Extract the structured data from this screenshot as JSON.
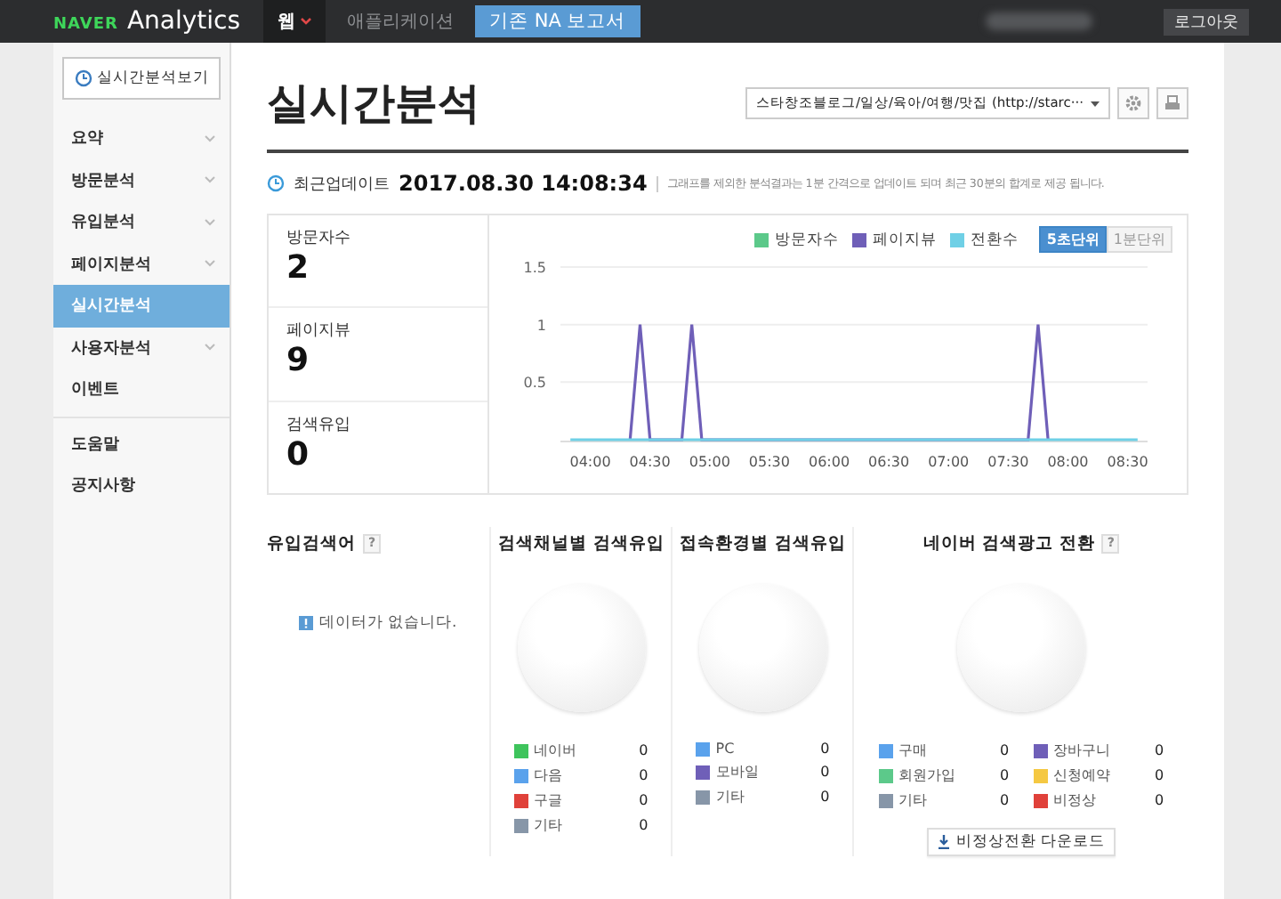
{
  "topbar": {
    "logo_brand": "NAVER",
    "logo_product": "Analytics",
    "tabs": [
      {
        "label": "웹",
        "selected": true,
        "kind": "menu"
      },
      {
        "label": "애플리케이션",
        "selected": false,
        "kind": "plain"
      },
      {
        "label": "기존 NA 보고서",
        "selected": false,
        "kind": "highlight"
      }
    ],
    "logout": "로그아웃"
  },
  "sidebar": {
    "realtime_button": "실시간분석보기",
    "items": [
      {
        "label": "요약",
        "selected": false,
        "has_submenu": true
      },
      {
        "label": "방문분석",
        "selected": false,
        "has_submenu": true
      },
      {
        "label": "유입분석",
        "selected": false,
        "has_submenu": true
      },
      {
        "label": "페이지분석",
        "selected": false,
        "has_submenu": true
      },
      {
        "label": "실시간분석",
        "selected": true,
        "has_submenu": false
      },
      {
        "label": "사용자분석",
        "selected": false,
        "has_submenu": true
      },
      {
        "label": "이벤트",
        "selected": false,
        "has_submenu": false
      }
    ],
    "help_items": [
      {
        "label": "도움말",
        "selected": false
      },
      {
        "label": "공지사항",
        "selected": false
      }
    ]
  },
  "page": {
    "title": "실시간분석",
    "site_select": "스타창조블로그/일상/육아/여행/맛집 (http://starc···"
  },
  "update": {
    "label": "최근업데이트",
    "timestamp": "2017.08.30 14:08:34",
    "note": "그래프를 제외한 분석결과는 1분 간격으로 업데이트 되며 최근 30분의 합계로 제공 됩니다."
  },
  "stats": [
    {
      "label": "방문자수",
      "value": "2"
    },
    {
      "label": "페이지뷰",
      "value": "9"
    },
    {
      "label": "검색유입",
      "value": "0"
    }
  ],
  "realtime_chart": {
    "units": [
      {
        "label": "5초단위",
        "selected": true
      },
      {
        "label": "1분단위",
        "selected": false
      }
    ],
    "chart_data": {
      "type": "line",
      "x": [
        230,
        260,
        265,
        270,
        286,
        291,
        296,
        460,
        465,
        470,
        515
      ],
      "series": [
        {
          "name": "방문자수",
          "color": "#5cc98a",
          "values": [
            null,
            null,
            null,
            null,
            null,
            null,
            null,
            null,
            null,
            null,
            null
          ]
        },
        {
          "name": "페이지뷰",
          "color": "#6f5fb8",
          "values": [
            null,
            0,
            1,
            0,
            0,
            1,
            0,
            0,
            1,
            0,
            null
          ]
        },
        {
          "name": "전환수",
          "color": "#6fd0e6",
          "values": [
            0,
            0,
            0,
            0,
            0,
            0,
            0,
            0,
            0,
            0,
            0
          ]
        }
      ],
      "xlim": [
        225,
        520
      ],
      "ylim": [
        0,
        1.5
      ],
      "xticks": [
        {
          "value": 240,
          "label": "04:00"
        },
        {
          "value": 270,
          "label": "04:30"
        },
        {
          "value": 300,
          "label": "05:00"
        },
        {
          "value": 330,
          "label": "05:30"
        },
        {
          "value": 360,
          "label": "06:00"
        },
        {
          "value": 390,
          "label": "06:30"
        },
        {
          "value": 420,
          "label": "07:00"
        },
        {
          "value": 450,
          "label": "07:30"
        },
        {
          "value": 480,
          "label": "08:00"
        },
        {
          "value": 510,
          "label": "08:30"
        }
      ],
      "yticks": [
        0.5,
        1,
        1.5
      ]
    }
  },
  "keywords": {
    "title": "유입검색어",
    "help": "?",
    "empty": "데이터가 없습니다."
  },
  "panels": [
    {
      "title": "검색채널별 검색유입",
      "legend": [
        {
          "label": "네이버",
          "value": "0",
          "color": "#3ec45c"
        },
        {
          "label": "다음",
          "value": "0",
          "color": "#5aa2ec"
        },
        {
          "label": "구글",
          "value": "0",
          "color": "#e0413a"
        },
        {
          "label": "기타",
          "value": "0",
          "color": "#8796a8"
        }
      ]
    },
    {
      "title": "접속환경별 검색유입",
      "legend": [
        {
          "label": "PC",
          "value": "0",
          "color": "#5aa2ec"
        },
        {
          "label": "모바일",
          "value": "0",
          "color": "#6f5fb8"
        },
        {
          "label": "기타",
          "value": "0",
          "color": "#8796a8"
        }
      ]
    },
    {
      "title": "네이버 검색광고 전환",
      "help": "?",
      "legend": [
        {
          "label": "구매",
          "value": "0",
          "color": "#5aa2ec"
        },
        {
          "label": "장바구니",
          "value": "0",
          "color": "#6f5fb8"
        },
        {
          "label": "회원가입",
          "value": "0",
          "color": "#5cc98a"
        },
        {
          "label": "신청예약",
          "value": "0",
          "color": "#f5c842"
        },
        {
          "label": "기타",
          "value": "0",
          "color": "#8796a8"
        },
        {
          "label": "비정상",
          "value": "0",
          "color": "#e0413a"
        }
      ],
      "download": "비정상전환 다운로드"
    }
  ]
}
